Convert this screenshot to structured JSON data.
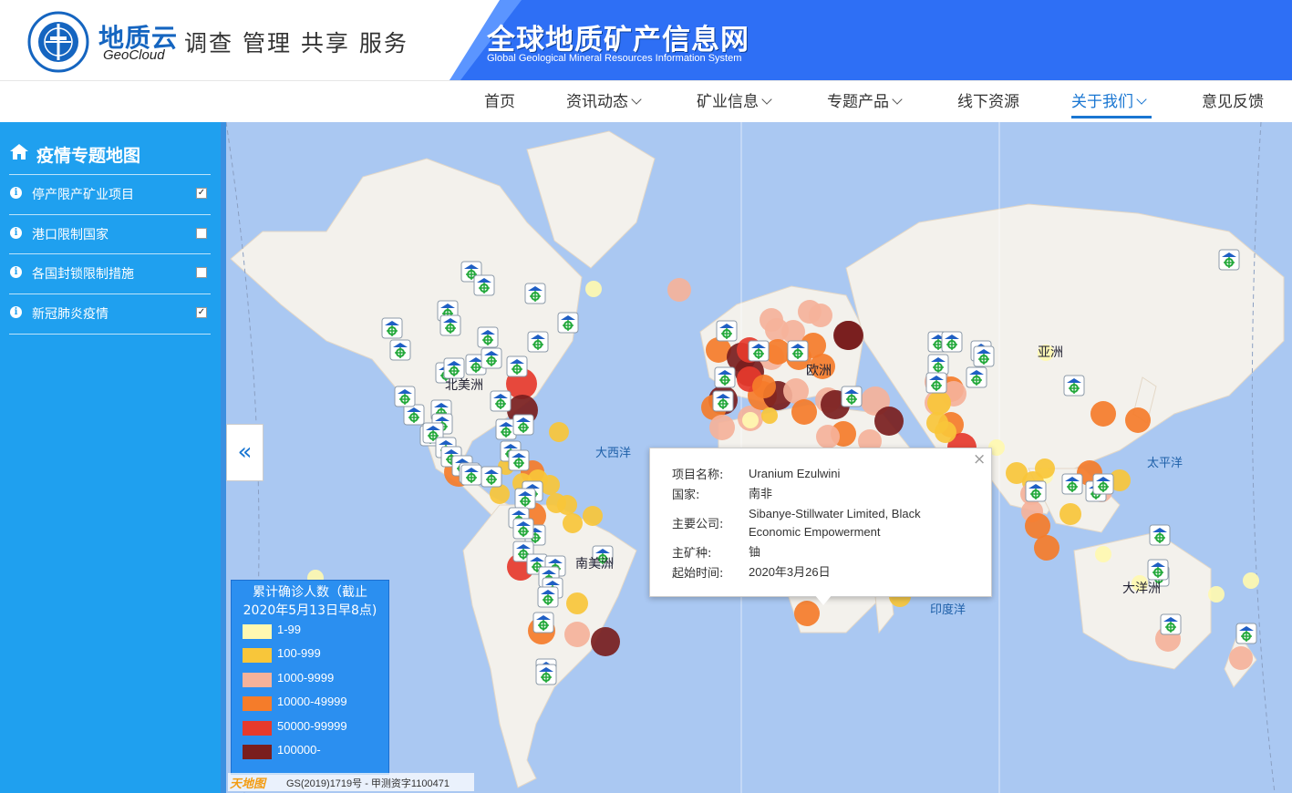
{
  "header": {
    "logo_cn": "地质云",
    "logo_en": "GeoCloud",
    "slogan": "调查 管理 共享 服务",
    "site_title": "全球地质矿产信息网",
    "site_subtitle": "Global Geological  Mineral Resources Information System",
    "banner_color": "#2e6ff5"
  },
  "nav": {
    "items": [
      {
        "label": "首页",
        "dropdown": false
      },
      {
        "label": "资讯动态",
        "dropdown": true
      },
      {
        "label": "矿业信息",
        "dropdown": true
      },
      {
        "label": "专题产品",
        "dropdown": true
      },
      {
        "label": "线下资源",
        "dropdown": false
      },
      {
        "label": "关于我们",
        "dropdown": true,
        "active": true
      },
      {
        "label": "意见反馈",
        "dropdown": false
      }
    ],
    "active_color": "#1976d2"
  },
  "sidebar": {
    "title": "疫情专题地图",
    "title_icon": "home-icon",
    "items": [
      {
        "label": "停产限产矿业项目",
        "checked": true,
        "icon": "info-icon"
      },
      {
        "label": "港口限制国家",
        "checked": false,
        "icon": "info-icon"
      },
      {
        "label": "各国封锁限制措施",
        "checked": false,
        "icon": "info-icon"
      },
      {
        "label": "新冠肺炎疫情",
        "checked": true,
        "icon": "info-icon"
      }
    ],
    "color": "#1fa0ef",
    "collapse_icon": "double-chevron-left-icon",
    "collapse_label": "«"
  },
  "map": {
    "continents": [
      "北美洲",
      "南美洲",
      "欧洲",
      "亚洲",
      "大洋洲"
    ],
    "oceans": [
      "大西洋",
      "太平洋",
      "印度洋"
    ],
    "ocean_color": "#aac8f2",
    "land_color": "#f3f1ec"
  },
  "legend": {
    "title_line1": "累计确诊人数（截止",
    "title_line2": "2020年5月13日早8点)",
    "items": [
      {
        "label": "1-99",
        "color": "#fff8b0"
      },
      {
        "label": "100-999",
        "color": "#f8c63a"
      },
      {
        "label": "1000-9999",
        "color": "#f5b29a"
      },
      {
        "label": "10000-49999",
        "color": "#f57c2a"
      },
      {
        "label": "50000-99999",
        "color": "#e63a2c"
      },
      {
        "label": "100000-",
        "color": "#7a1e1e"
      }
    ]
  },
  "attribution": {
    "logo": "天地图",
    "text": "GS(2019)1719号 - 甲测资字1100471"
  },
  "popup": {
    "close": "×",
    "rows": [
      {
        "key": "项目名称:",
        "value": "Uranium Ezulwini"
      },
      {
        "key": "国家:",
        "value": "南非"
      },
      {
        "key": "主要公司:",
        "value": "Sibanye-Stillwater Limited, Black Economic Empowerment"
      },
      {
        "key": "主矿种:",
        "value": "铀"
      },
      {
        "key": "起始时间:",
        "value": "2020年3月26日"
      }
    ]
  }
}
